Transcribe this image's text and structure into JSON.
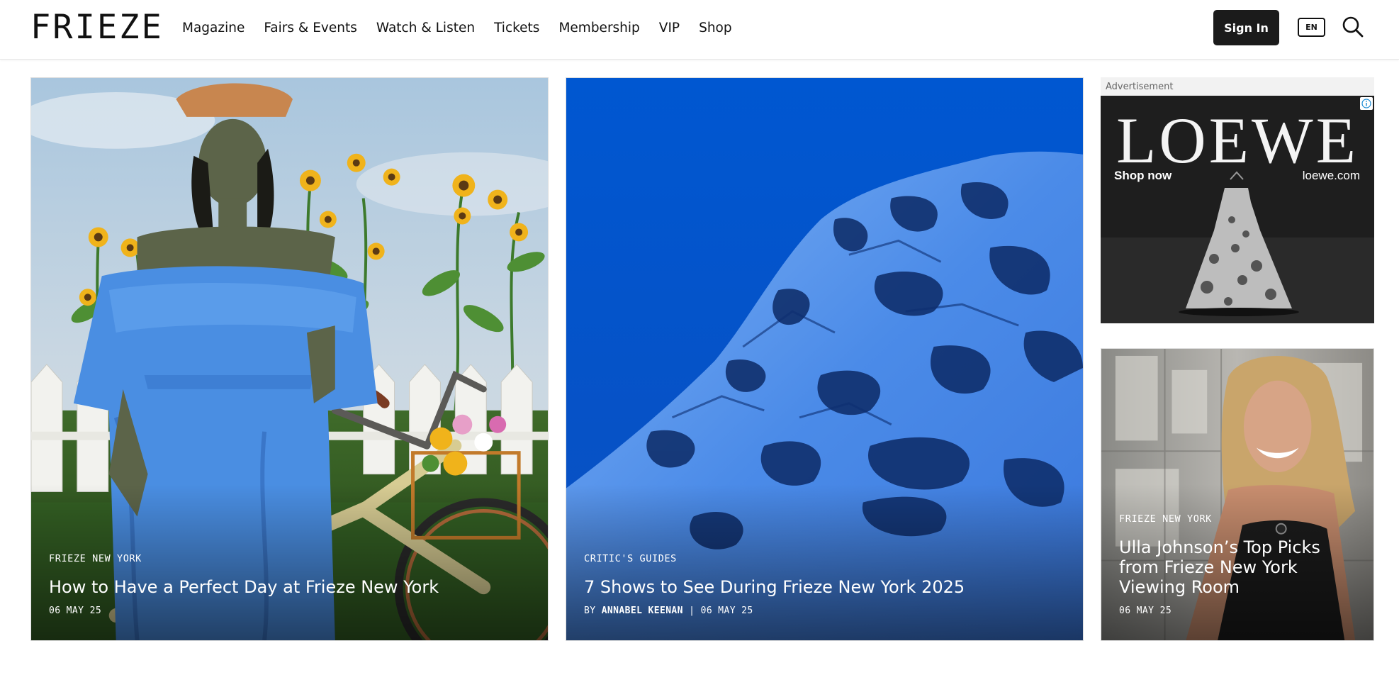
{
  "header": {
    "logo": "FRIEZE",
    "nav": [
      "Magazine",
      "Fairs & Events",
      "Watch & Listen",
      "Tickets",
      "Membership",
      "VIP",
      "Shop"
    ],
    "sign_in": "Sign In",
    "language": "EN",
    "search_icon": "search-icon"
  },
  "cards": [
    {
      "category": "FRIEZE NEW YORK",
      "title": "How to Have a Perfect Day at Frieze New York",
      "date": "06 MAY 25",
      "image": "painting of a woman in a blue dress leaning on a bicycle with sunflowers"
    },
    {
      "category": "CRITIC'S GUIDES",
      "title": "7 Shows to See During Frieze New York 2025",
      "byline_prefix": "BY",
      "author": "ANNABEL KEENAN",
      "separator": "|",
      "date": "06 MAY 25",
      "image": "blue snowy mountain"
    },
    {
      "category": "FRIEZE NEW YORK",
      "title": "Ulla Johnson’s Top Picks from Frieze New York Viewing Room",
      "date": "06 MAY 25",
      "image": "portrait of a smiling woman with blonde hair"
    }
  ],
  "ad": {
    "label": "Advertisement",
    "brand": "LOEWE",
    "cta": "Shop now",
    "url": "loewe.com",
    "info_icon": "info-icon"
  },
  "colors": {
    "text": "#111111",
    "sign_in_bg": "#1b1b1b",
    "header_border": "#e6e6e6",
    "mountain_blue": "#0057d1"
  }
}
